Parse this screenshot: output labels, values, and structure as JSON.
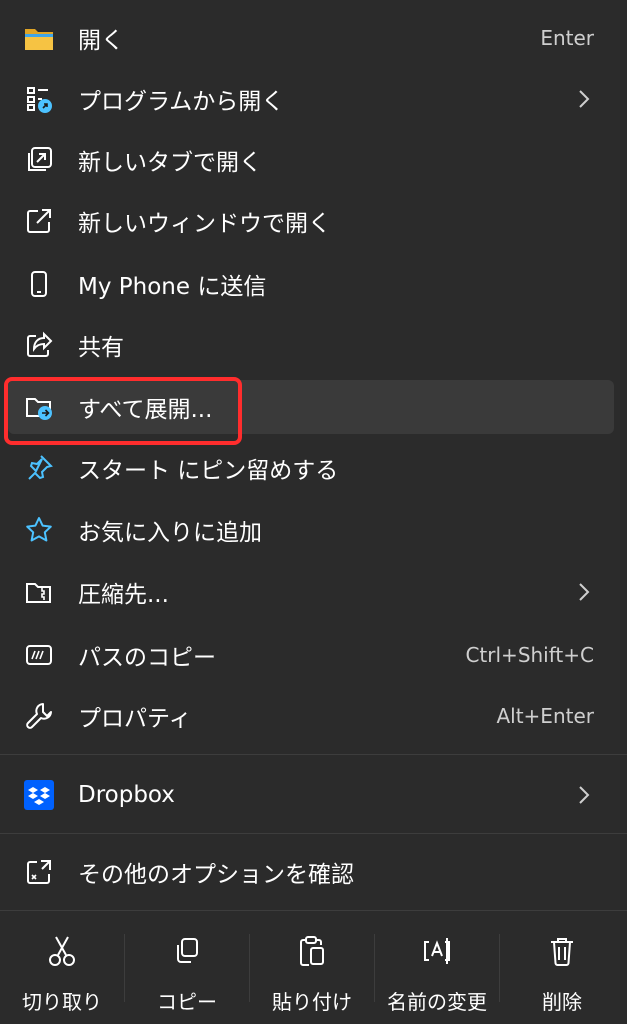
{
  "menu": {
    "items": [
      {
        "label": "開く",
        "shortcut": "Enter"
      },
      {
        "label": "プログラムから開く"
      },
      {
        "label": "新しいタブで開く"
      },
      {
        "label": "新しいウィンドウで開く"
      },
      {
        "label": "My Phone に送信"
      },
      {
        "label": "共有"
      },
      {
        "label": "すべて展開..."
      },
      {
        "label": "スタート にピン留めする"
      },
      {
        "label": "お気に入りに追加"
      },
      {
        "label": "圧縮先..."
      },
      {
        "label": "パスのコピー",
        "shortcut": "Ctrl+Shift+C"
      },
      {
        "label": "プロパティ",
        "shortcut": "Alt+Enter"
      }
    ],
    "dropbox": {
      "label": "Dropbox"
    },
    "more_options": {
      "label": "その他のオプションを確認"
    }
  },
  "toolbar": {
    "cut": "切り取り",
    "copy": "コピー",
    "paste": "貼り付け",
    "rename": "名前の変更",
    "delete": "削除"
  },
  "colors": {
    "background": "#2b2b2b",
    "hover": "#3a3a3a",
    "accent": "#4cc2ff",
    "highlight": "#ff2d2d",
    "folder": "#f6c343",
    "dropbox": "#0061fe"
  }
}
